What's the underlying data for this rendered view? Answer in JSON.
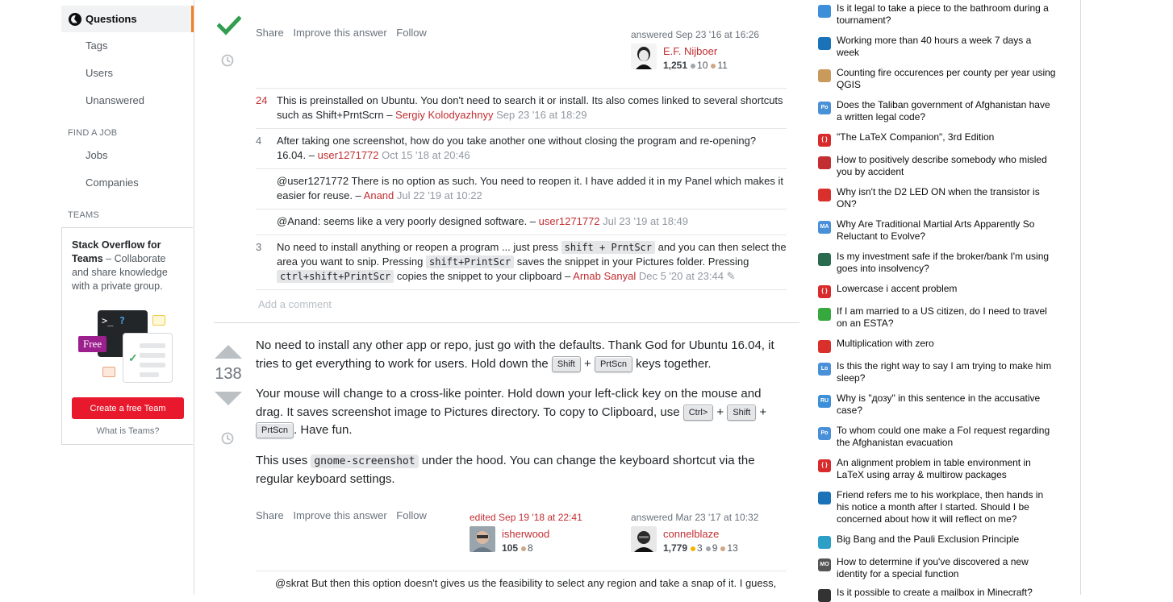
{
  "leftnav": {
    "questions": "Questions",
    "tags": "Tags",
    "users": "Users",
    "unanswered": "Unanswered",
    "find_job_heading": "FIND A JOB",
    "jobs": "Jobs",
    "companies": "Companies",
    "teams_heading": "TEAMS",
    "teams_title": "Stack Overflow for Teams",
    "teams_desc": " – Collaborate and share knowledge with a private group.",
    "free_label": "Free",
    "terminal_prompt": ">_",
    "terminal_q": "?",
    "create_team_label": "Create a free Team",
    "what_is_teams": "What is Teams?"
  },
  "answer1": {
    "menu": {
      "share": "Share",
      "improve": "Improve this answer",
      "follow": "Follow"
    },
    "answered": "answered Sep 23 '16 at 16:26",
    "user": "E.F. Nijboer",
    "rep": "1,251",
    "silver": "10",
    "bronze": "11",
    "comments": [
      {
        "score": "24",
        "text": "This is preinstalled on Ubuntu. You don't need to search it or install. Its also comes linked to several shortcuts such as Shift+PrntScrn – ",
        "user": "Sergiy Kolodyazhnyy",
        "time": "Sep 23 '16 at 18:29"
      },
      {
        "score": "4",
        "text": "After taking one screenshot, how do you take another one without closing the program and re-opening? 16.04. – ",
        "user": "user1271772",
        "time": "Oct 15 '18 at 20:46"
      },
      {
        "score": "",
        "text": "@user1271772 There is no option as such. You need to reopen it. I have added it in my Panel which makes it easier for reuse. – ",
        "user": "Anand",
        "time": "Jul 22 '19 at 10:22"
      },
      {
        "score": "",
        "text": "@Anand: seems like a very poorly designed software. – ",
        "user": "user1271772",
        "time": "Jul 23 '19 at 18:49"
      }
    ],
    "comment5": {
      "score": "3",
      "t1": "No need to install anything or reopen a program ... just press ",
      "c1": "shift + PrntScr",
      "t2": " and you can then select the area you want to snip. Pressing ",
      "c2": "shift+PrintScr",
      "t3": " saves the snippet in your Pictures folder. Pressing ",
      "c3": "ctrl+shift+PrintScr",
      "t4": " copies the snippet to your clipboard – ",
      "user": "Arnab Sanyal",
      "time": "Dec 5 '20 at 23:44",
      "edit_glyph": "✎"
    },
    "add_comment": "Add a comment"
  },
  "answer2": {
    "votes": "138",
    "p1a": "No need to install any other app or repo, just go with the defaults. Thank God for Ubuntu 16.04, it tries to get everything to work for users. Hold down the ",
    "k_shift": "Shift",
    "plus": "+",
    "k_prtscn": "PrtScn",
    "p1b": " keys together.",
    "p2a": "Your mouse will change to a cross-like pointer. Hold down your left-click key on the mouse and drag. It saves screenshot image to Pictures directory. To copy to Clipboard, use ",
    "k_ctrl": "Ctrl>",
    "p2b": ". Have fun.",
    "p3a": "This uses ",
    "code": "gnome-screenshot",
    "p3b": " under the hood. You can change the keyboard shortcut via the regular keyboard settings.",
    "menu": {
      "share": "Share",
      "improve": "Improve this answer",
      "follow": "Follow"
    },
    "edited": "edited Sep 19 '18 at 22:41",
    "editor": "isherwood",
    "editor_rep": "105",
    "editor_bronze": "8",
    "answered": "answered Mar 23 '17 at 10:32",
    "user": "connelblaze",
    "rep": "1,779",
    "gold": "3",
    "silver": "9",
    "bronze": "13",
    "comment": "@skrat But then this option doesn't gives us the feasibility to select any region and take a snap of it. I guess,"
  },
  "hot_questions": [
    {
      "title": "Is it legal to take a piece to the bathroom during a tournament?",
      "icon": "chess-se-icon",
      "color": "#3c8fd8"
    },
    {
      "title": "Working more than 40 hours a week 7 days a week",
      "icon": "workplace-se-icon",
      "color": "#1a73b8"
    },
    {
      "title": "Counting fire occurences per county per year using QGIS",
      "icon": "gis-se-icon",
      "color": "#c99a5c"
    },
    {
      "title": "Does the Taliban government of Afghanistan have a written legal code?",
      "icon": "politics-se-icon",
      "color": "#4a90d9"
    },
    {
      "title": "\"The LaTeX Companion\", 3rd Edition",
      "icon": "tex-se-icon",
      "color": "#d92b2b"
    },
    {
      "title": "How to positively describe somebody who misled you by accident",
      "icon": "english-se-icon",
      "color": "#c22e32"
    },
    {
      "title": "Why isn't the D2 LED ON when the transistor is ON?",
      "icon": "electronics-se-icon",
      "color": "#d9302c"
    },
    {
      "title": "Why Are Traditional Martial Arts Apparently So Reluctant to Evolve?",
      "icon": "martialarts-se-icon",
      "color": "#4a90d9"
    },
    {
      "title": "Is my investment safe if the broker/bank I'm using goes into insolvency?",
      "icon": "money-se-icon",
      "color": "#2a6a4f"
    },
    {
      "title": "Lowercase i accent problem",
      "icon": "tex-se-icon",
      "color": "#d92b2b"
    },
    {
      "title": "If I am married to a US citizen, do I need to travel on an ESTA?",
      "icon": "travel-se-icon",
      "color": "#36a83e"
    },
    {
      "title": "Multiplication with zero",
      "icon": "math-se-icon",
      "color": "#d9302c"
    },
    {
      "title": "Is this the right way to say I am trying to make him sleep?",
      "icon": "language-se-icon",
      "color": "#4a90d9"
    },
    {
      "title": "Why is \"дозу\" in this sentence in the accusative case?",
      "icon": "russian-se-icon",
      "color": "#3c8fd8"
    },
    {
      "title": "To whom could one make a FoI request regarding the Afghanistan evacuation",
      "icon": "politics-se-icon",
      "color": "#4a90d9"
    },
    {
      "title": "An alignment problem in table environment in LaTeX using array & multirow packages",
      "icon": "tex-se-icon",
      "color": "#d92b2b"
    },
    {
      "title": "Friend refers me to his workplace, then hands in his notice a month after I started. Should I be concerned about how it will reflect on me?",
      "icon": "workplace-se-icon",
      "color": "#1a73b8"
    },
    {
      "title": "Big Bang and the Pauli Exclusion Principle",
      "icon": "physics-se-icon",
      "color": "#2c9fc7"
    },
    {
      "title": "How to determine if you've discovered a new identity for a special function",
      "icon": "mathoverflow-icon",
      "color": "#555555"
    },
    {
      "title": "Is it possible to create a mailbox in Minecraft?",
      "icon": "gaming-se-icon",
      "color": "#333333"
    }
  ],
  "hot_icon_labels": [
    "",
    "",
    "",
    "Po",
    "{ }",
    "",
    "",
    "MA",
    "",
    "{ }",
    "",
    "",
    "Lo",
    "RU",
    "Po",
    "{ }",
    "",
    "",
    "MO",
    ""
  ]
}
